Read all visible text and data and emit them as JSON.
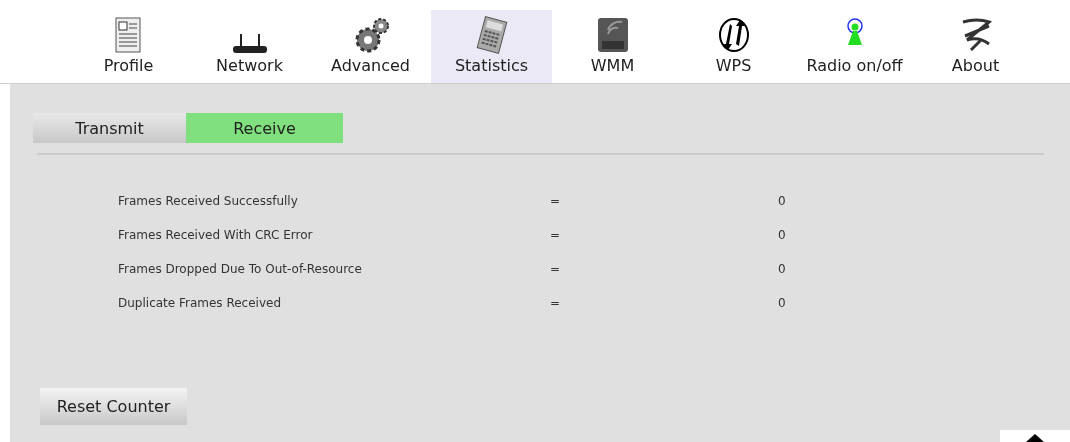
{
  "toolbar": [
    {
      "label": "Profile",
      "selected": false
    },
    {
      "label": "Network",
      "selected": false
    },
    {
      "label": "Advanced",
      "selected": false
    },
    {
      "label": "Statistics",
      "selected": true
    },
    {
      "label": "WMM",
      "selected": false
    },
    {
      "label": "WPS",
      "selected": false
    },
    {
      "label": "Radio on/off",
      "selected": false
    },
    {
      "label": "About",
      "selected": false
    }
  ],
  "tabs": [
    {
      "label": "Transmit",
      "selected": false
    },
    {
      "label": "Receive",
      "selected": true
    }
  ],
  "stats": [
    {
      "name": "Frames Received Successfully",
      "sign": "=",
      "value": "0"
    },
    {
      "name": "Frames Received With CRC Error",
      "sign": "=",
      "value": "0"
    },
    {
      "name": "Frames Dropped Due To Out-of-Resource",
      "sign": "=",
      "value": "0"
    },
    {
      "name": "Duplicate Frames Received",
      "sign": "=",
      "value": "0"
    }
  ],
  "reset_button": "Reset Counter"
}
